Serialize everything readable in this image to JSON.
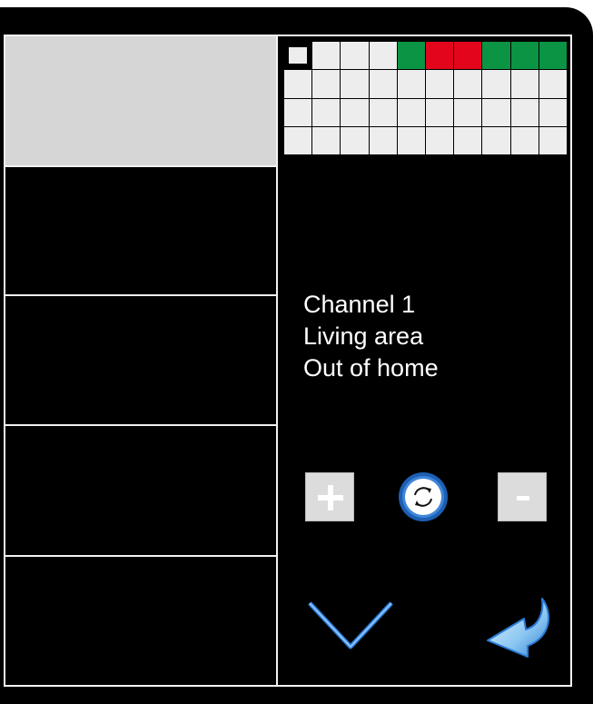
{
  "info": {
    "line1": "Channel 1",
    "line2": "Living area",
    "line3": "Out of home"
  },
  "controls": {
    "plus_label": "+",
    "minus_label": "-"
  },
  "schedule_grid": {
    "rows": 4,
    "columns": 10,
    "row1": [
      "selected",
      "empty",
      "empty",
      "empty",
      "green",
      "red",
      "red",
      "green",
      "green",
      "green"
    ],
    "row2": [
      "empty",
      "empty",
      "empty",
      "empty",
      "empty",
      "empty",
      "empty",
      "empty",
      "empty",
      "empty"
    ],
    "row3": [
      "empty",
      "empty",
      "empty",
      "empty",
      "empty",
      "empty",
      "empty",
      "empty",
      "empty",
      "empty"
    ],
    "row4": [
      "empty",
      "empty",
      "empty",
      "empty",
      "empty",
      "empty",
      "empty",
      "empty",
      "empty",
      "empty"
    ]
  },
  "colors": {
    "background": "#000000",
    "active_tile": "#d6d6d6",
    "grid_empty": "#ededed",
    "grid_green": "#0a9443",
    "grid_red": "#e3051b",
    "accent_blue": "#2b7bd6"
  },
  "icons": {
    "plus": "plus-icon",
    "refresh": "refresh-icon",
    "minus": "minus-icon",
    "down": "chevron-down-icon",
    "back": "back-arrow-icon"
  },
  "menu": {
    "tiles": [
      "active",
      "inactive",
      "inactive",
      "inactive",
      "inactive"
    ]
  }
}
